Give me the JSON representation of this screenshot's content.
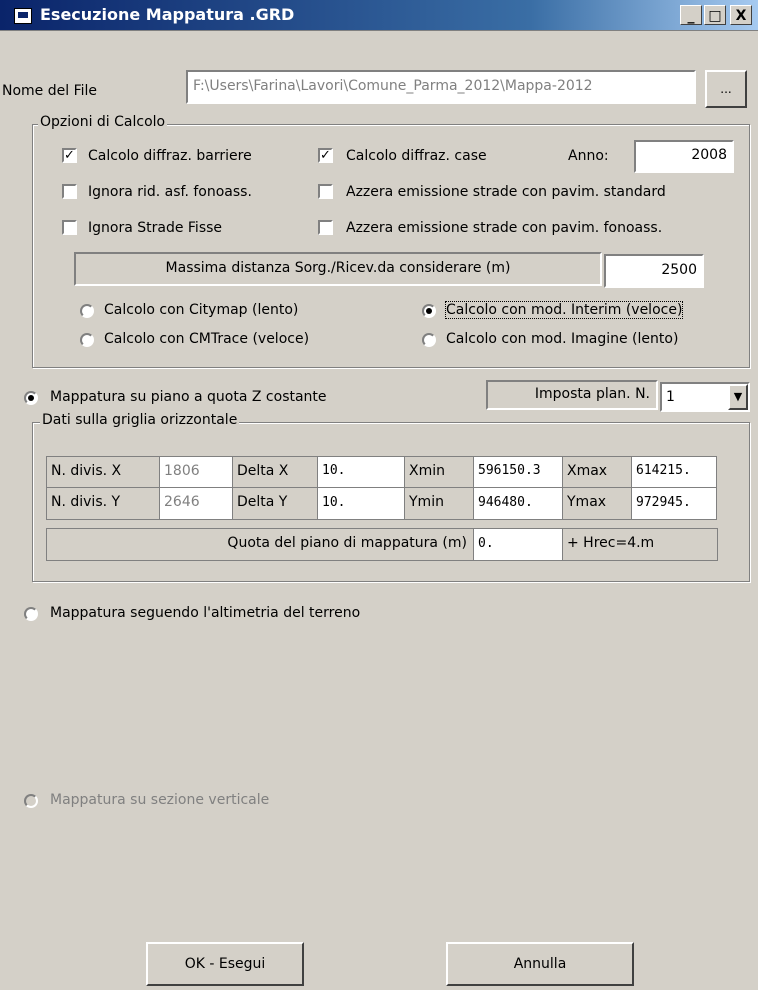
{
  "window": {
    "title": "Esecuzione Mappatura .GRD",
    "controls": [
      "_",
      "□",
      "X"
    ]
  },
  "file": {
    "label": "Nome del File",
    "value": "F:\\Users\\Farina\\Lavori\\Comune_Parma_2012\\Mappa-2012",
    "browse_label": "..."
  },
  "options": {
    "legend": "Opzioni di Calcolo",
    "barriers": "Calcolo diffraz. barriere",
    "houses": "Calcolo diffraz. case",
    "anno_label": "Anno:",
    "anno_value": "2008",
    "ignore_asf": "Ignora rid. asf. fonoass.",
    "zero_standard": "Azzera emissione strade con pavim. standard",
    "ignore_fixed": "Ignora Strade Fisse",
    "zero_fonoass": "Azzera emissione strade con pavim. fonoass.",
    "max_dist_label": "Massima distanza Sorg./Ricev.da considerare (m)",
    "max_dist_value": "2500",
    "citymap": "Calcolo con Citymap (lento)",
    "interim": "Calcolo con mod. Interim (veloce)",
    "cmtrace": "Calcolo con CMTrace (veloce)",
    "imagine": "Calcolo con mod. Imagine (lento)"
  },
  "mapping_constant": {
    "label": "Mappatura su piano a quota Z costante",
    "plan_label": "Imposta plan. N.",
    "plan_value": "1"
  },
  "grid": {
    "legend": "Dati sulla griglia orizzontale",
    "row1": {
      "ndiv_label": "N. divis. X",
      "ndiv": "1806",
      "delta_label": "Delta X",
      "delta": "10.",
      "min_label": "Xmin",
      "min": "596150.3",
      "max_label": "Xmax",
      "max": "614215."
    },
    "row2": {
      "ndiv_label": "N. divis. Y",
      "ndiv": "2646",
      "delta_label": "Delta Y",
      "delta": "10.",
      "min_label": "Ymin",
      "min": "946480.",
      "max_label": "Ymax",
      "max": "972945."
    },
    "quota_label": "Quota del piano di mappatura (m)",
    "quota_value": "0.",
    "hrec": "+ Hrec=4.m"
  },
  "mapping_terrain": "Mappatura seguendo l'altimetria del terreno",
  "mapping_vertical": "Mappatura su sezione verticale",
  "buttons": {
    "ok": "OK - Esegui",
    "cancel": "Annulla"
  }
}
